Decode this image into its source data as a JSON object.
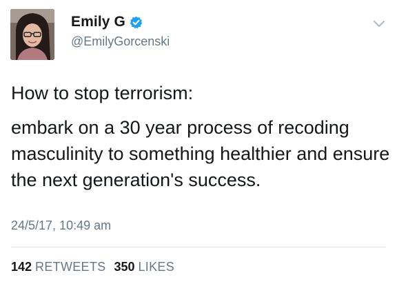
{
  "user": {
    "display_name": "Emily G",
    "handle": "@EmilyGorcenski",
    "verified": true
  },
  "tweet": {
    "paragraphs": [
      "How to stop terrorism:",
      "embark on a 30 year process of recoding masculinity to something healthier and ensure the next generation's success."
    ],
    "timestamp": "24/5/17, 10:49 am"
  },
  "stats": {
    "retweets_count": "142",
    "retweets_label": "RETWEETS",
    "likes_count": "350",
    "likes_label": "LIKES"
  },
  "icons": {
    "verified": "verified-badge-icon",
    "menu": "chevron-down-icon"
  },
  "colors": {
    "verified_blue": "#1da1f2",
    "secondary_text": "#657786",
    "primary_text": "#14171a",
    "divider": "#e1e8ed"
  }
}
